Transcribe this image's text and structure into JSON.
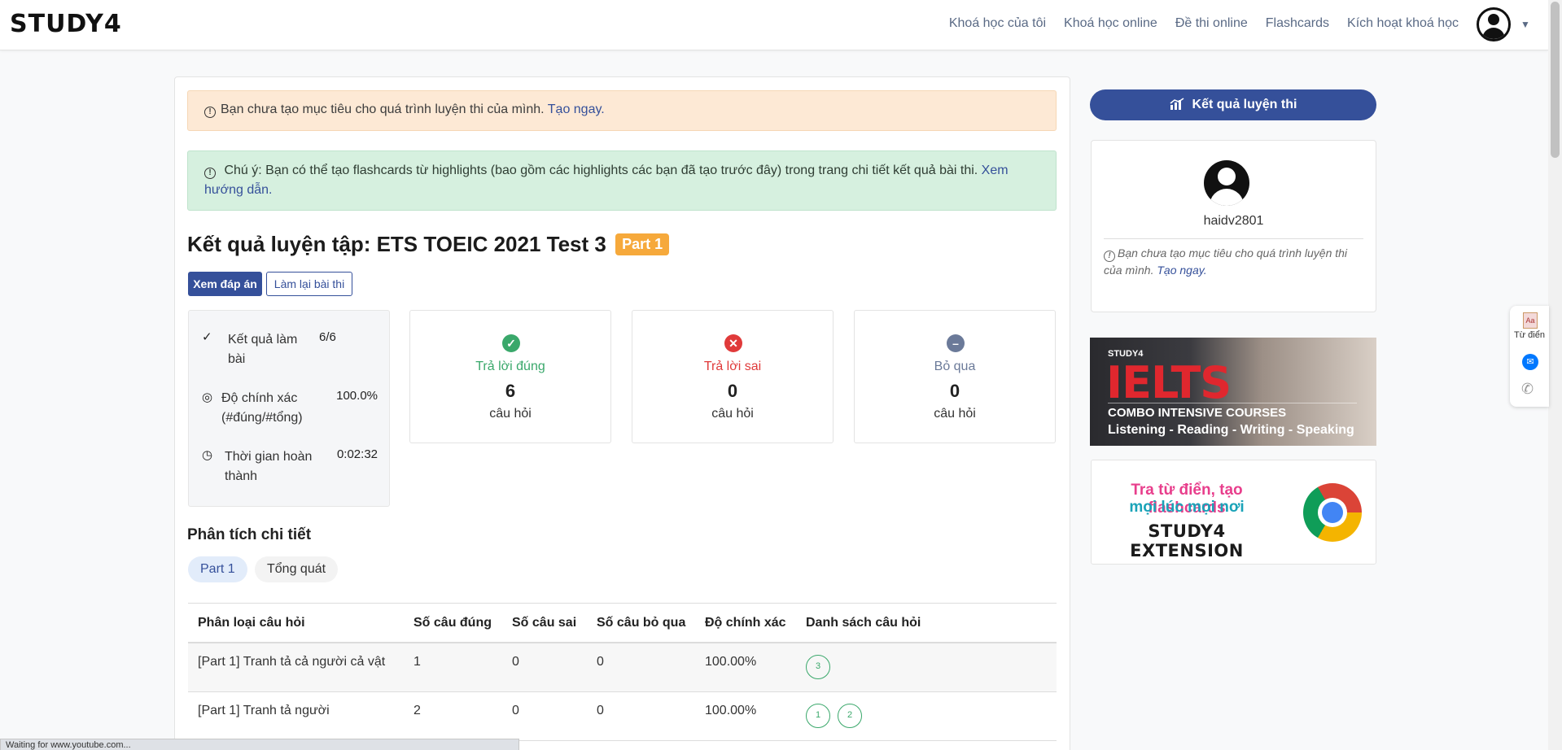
{
  "header": {
    "logo": "STUDY4",
    "nav": [
      "Khoá học của tôi",
      "Khoá học online",
      "Đề thi online",
      "Flashcards",
      "Kích hoạt khoá học"
    ]
  },
  "alerts": {
    "goal_text": "Bạn chưa tạo mục tiêu cho quá trình luyện thi của mình.",
    "goal_link": "Tạo ngay.",
    "note_text": "Chú ý: Bạn có thể tạo flashcards từ highlights (bao gồm các highlights các bạn đã tạo trước đây) trong trang chi tiết kết quả bài thi.",
    "note_link": "Xem hướng dẫn."
  },
  "result": {
    "title": "Kết quả luyện tập: ETS TOEIC 2021 Test 3",
    "badge": "Part 1",
    "view_answers": "Xem đáp án",
    "retry": "Làm lại bài thi"
  },
  "summary": {
    "result_label": "Kết quả làm bài",
    "result_value": "6/6",
    "accuracy_label": "Độ chính xác (#đúng/#tổng)",
    "accuracy_value": "100.0%",
    "time_label": "Thời gian hoàn thành",
    "time_value": "0:02:32"
  },
  "stats": [
    {
      "label": "Trả lời đúng",
      "value": "6",
      "unit": "câu hỏi",
      "color": "#3aa86b",
      "icon": "check-circle-icon"
    },
    {
      "label": "Trả lời sai",
      "value": "0",
      "unit": "câu hỏi",
      "color": "#e03a3a",
      "icon": "x-circle-icon"
    },
    {
      "label": "Bỏ qua",
      "value": "0",
      "unit": "câu hỏi",
      "color": "#6b7a99",
      "icon": "minus-circle-icon"
    }
  ],
  "analysis": {
    "heading": "Phân tích chi tiết",
    "tabs": [
      "Part 1",
      "Tổng quát"
    ],
    "columns": [
      "Phân loại câu hỏi",
      "Số câu đúng",
      "Số câu sai",
      "Số câu bỏ qua",
      "Độ chính xác",
      "Danh sách câu hỏi"
    ],
    "rows": [
      {
        "category": "[Part 1] Tranh tả cả người cả vật",
        "correct": "1",
        "wrong": "0",
        "skipped": "0",
        "accuracy": "100.00%",
        "questions": [
          "3"
        ]
      },
      {
        "category": "[Part 1] Tranh tả người",
        "correct": "2",
        "wrong": "0",
        "skipped": "0",
        "accuracy": "100.00%",
        "questions": [
          "1",
          "2"
        ]
      }
    ]
  },
  "sidebar": {
    "result_button": "Kết quả luyện thi",
    "username": "haidv2801",
    "goal_text": "Bạn chưa tạo mục tiêu cho quá trình luyện thi của mình.",
    "goal_link": "Tạo ngay.",
    "banner_ielts": {
      "brand": "STUDY4",
      "headline": "IELTS",
      "line1": "COMBO INTENSIVE COURSES",
      "line2": "Listening - Reading - Writing - Speaking"
    },
    "banner_extension": {
      "line1": "Tra từ điển, tạo flashcards",
      "line2": "mọi lúc mọi nơi",
      "line3": "STUDY4 EXTENSION"
    }
  },
  "float_widget": {
    "dict_label": "Từ điển"
  },
  "statusbar": "Waiting for www.youtube.com..."
}
